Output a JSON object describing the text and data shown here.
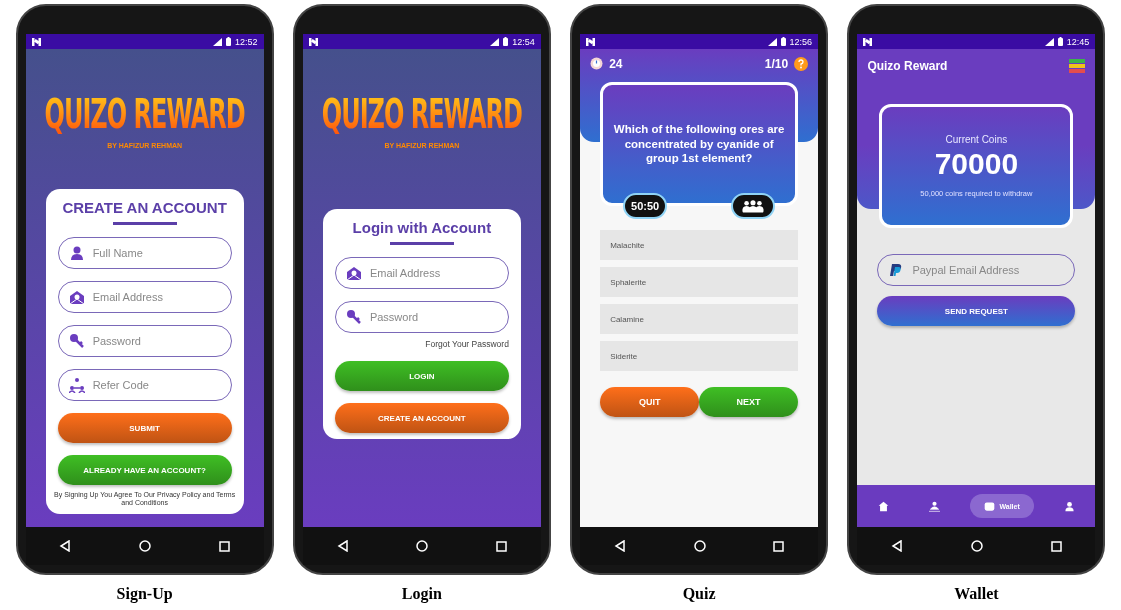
{
  "screens": [
    {
      "kind": "signup",
      "caption": "Sign-Up",
      "status_time": "12:52",
      "logo": {
        "title": "QUIZO REWARD",
        "subtitle": "BY HAFIZUR REHMAN"
      },
      "card_title": "CREATE AN ACCOUNT",
      "fields": [
        {
          "placeholder": "Full Name"
        },
        {
          "placeholder": "Email Address"
        },
        {
          "placeholder": "Password"
        },
        {
          "placeholder": "Refer Code"
        }
      ],
      "buttons": [
        {
          "label": "SUBMIT",
          "color": "#ff6f1a"
        },
        {
          "label": "ALREADY HAVE AN ACCOUNT?",
          "color": "#3fbf24"
        }
      ],
      "terms": "By Signing Up You Agree To Our Privacy Policy and Terms and Conditions"
    },
    {
      "kind": "login",
      "caption": "Login",
      "status_time": "12:54",
      "logo": {
        "title": "QUIZO REWARD",
        "subtitle": "BY HAFIZUR REHMAN"
      },
      "card_title": "Login with Account",
      "fields": [
        {
          "placeholder": "Email Address"
        },
        {
          "placeholder": "Password"
        }
      ],
      "forgot": "Forgot Your Password",
      "buttons": [
        {
          "label": "LOGIN",
          "color": "#3fbf24"
        },
        {
          "label": "CREATE AN ACCOUNT",
          "color": "#ff6f1a"
        }
      ]
    },
    {
      "kind": "quiz",
      "caption": "Quiz",
      "status_time": "12:56",
      "timer": "24",
      "progress": "1/10",
      "question": "Which of the following ores are concentrated by cyanide of group 1st element?",
      "lifeline": "50:50",
      "options": [
        "Malachite",
        "Sphalerite",
        "Calamine",
        "Siderite"
      ],
      "buttons": [
        {
          "label": "QUIT",
          "color": "#ff6f1a"
        },
        {
          "label": "NEXT",
          "color": "#3fbf24"
        }
      ]
    },
    {
      "kind": "wallet",
      "caption": "Wallet",
      "status_time": "12:45",
      "app_title": "Quizo Reward",
      "coins_label": "Current Coins",
      "coins": "70000",
      "coins_note": "50,000 coins required to withdraw",
      "field": {
        "placeholder": "Paypal Email Address"
      },
      "send_button": "SEND REQUEST",
      "nav": [
        {
          "selected": false
        },
        {
          "selected": false
        },
        {
          "label": "Wallet",
          "selected": true
        },
        {
          "selected": false
        }
      ]
    }
  ]
}
